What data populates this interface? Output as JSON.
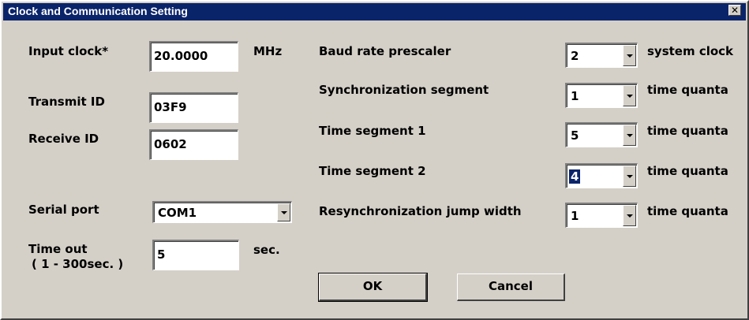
{
  "window": {
    "title": "Clock and Communication Setting",
    "close_glyph": "✕"
  },
  "left": {
    "input_clock": {
      "label": "Input clock*",
      "value": "20.0000",
      "unit": "MHz"
    },
    "transmit_id": {
      "label": "Transmit ID",
      "value": "03F9"
    },
    "receive_id": {
      "label": "Receive ID",
      "value": "0602"
    },
    "serial_port": {
      "label": "Serial port",
      "value": "COM1"
    },
    "time_out": {
      "label": "Time out",
      "range": "( 1 - 300sec. )",
      "value": "5",
      "unit": "sec."
    }
  },
  "right": {
    "baud_rate_prescaler": {
      "label": "Baud rate prescaler",
      "value": "2",
      "unit": "system clock"
    },
    "sync_segment": {
      "label": "Synchronization segment",
      "value": "1",
      "unit": "time quanta"
    },
    "time_segment_1": {
      "label": "Time segment 1",
      "value": "5",
      "unit": "time quanta"
    },
    "time_segment_2": {
      "label": "Time segment 2",
      "value": "4",
      "unit": "time quanta"
    },
    "resync_jump_width": {
      "label": "Resynchronization jump width",
      "value": "1",
      "unit": "time quanta"
    }
  },
  "buttons": {
    "ok": "OK",
    "cancel": "Cancel"
  },
  "colors": {
    "titlebar": "#0a246a",
    "face": "#d4d0c8",
    "selection": "#0a246a"
  }
}
